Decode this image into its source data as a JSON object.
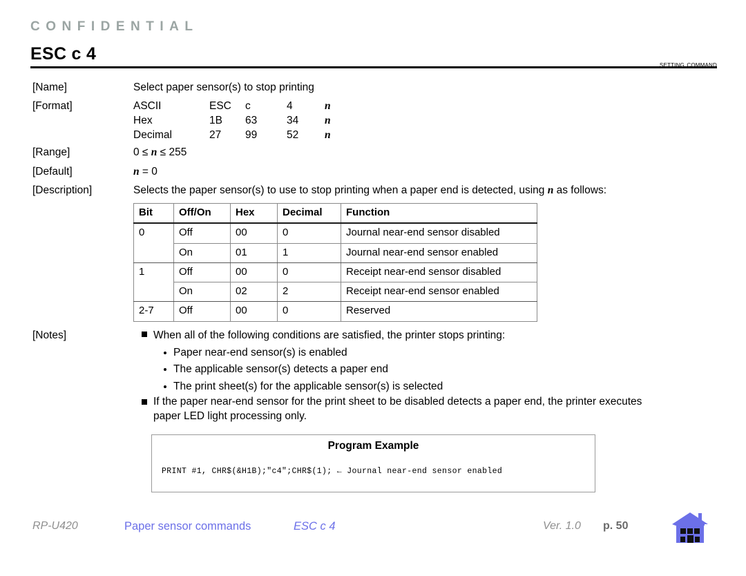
{
  "header": {
    "confidential": "CONFIDENTIAL",
    "command_title": "ESC c 4",
    "section_tag": "SETTING COMMAND"
  },
  "fields": {
    "name_label": "[Name]",
    "name_value": "Select paper sensor(s) to stop printing",
    "format_label": "[Format]",
    "format_rows": [
      {
        "type": "ASCII",
        "b1": "ESC",
        "b2": "c",
        "b3": "4",
        "b4": "n"
      },
      {
        "type": "Hex",
        "b1": "1B",
        "b2": "63",
        "b3": "34",
        "b4": "n"
      },
      {
        "type": "Decimal",
        "b1": "27",
        "b2": "99",
        "b3": "52",
        "b4": "n"
      }
    ],
    "range_label": "[Range]",
    "range_prefix": "0 ≤ ",
    "range_var": "n",
    "range_suffix": " ≤ 255",
    "default_label": "[Default]",
    "default_var": "n",
    "default_suffix": " = 0",
    "description_label": "[Description]",
    "description_pre": "Selects the paper sensor(s) to use to stop printing when a paper end is detected, using ",
    "description_var": "n",
    "description_post": " as follows:"
  },
  "bit_table": {
    "columns": [
      "Bit",
      "Off/On",
      "Hex",
      "Decimal",
      "Function"
    ],
    "rows": [
      {
        "bit": "0",
        "bit_span": 2,
        "offon": "Off",
        "hex": "00",
        "decimal": "0",
        "function": "Journal near-end sensor disabled"
      },
      {
        "bit": "",
        "bit_span": 0,
        "offon": "On",
        "hex": "01",
        "decimal": "1",
        "function": "Journal near-end sensor enabled"
      },
      {
        "bit": "1",
        "bit_span": 2,
        "offon": "Off",
        "hex": "00",
        "decimal": "0",
        "function": "Receipt near-end sensor disabled"
      },
      {
        "bit": "",
        "bit_span": 0,
        "offon": "On",
        "hex": "02",
        "decimal": "2",
        "function": "Receipt near-end sensor enabled"
      },
      {
        "bit": "2-7",
        "bit_span": 1,
        "offon": "Off",
        "hex": "00",
        "decimal": "0",
        "function": "Reserved"
      }
    ]
  },
  "notes": {
    "label": "[Notes]",
    "item1": "When all of the following conditions are satisfied, the printer stops printing:",
    "sub1": "Paper near-end sensor(s) is enabled",
    "sub2": "The applicable sensor(s) detects a paper end",
    "sub3": "The print sheet(s) for the applicable sensor(s) is selected",
    "item2_line1": "If the paper near-end sensor for the print sheet to be disabled detects a paper end, the printer executes",
    "item2_line2": "paper LED light processing only."
  },
  "program_example": {
    "title": "Program Example",
    "code": "PRINT #1, CHR$(&H1B);\"c4\";CHR$(1); ← Journal near-end sensor enabled"
  },
  "footer": {
    "model": "RP-U420",
    "section_link": "Paper sensor commands",
    "command_link": "ESC c 4",
    "version": "Ver. 1.0",
    "page": "p. 50",
    "home_icon": "home-icon"
  },
  "colors": {
    "confidential": "#9ba5a3",
    "link": "#6c70e8",
    "footer_gray": "#8f8f8f",
    "house": "#6c70e8"
  }
}
